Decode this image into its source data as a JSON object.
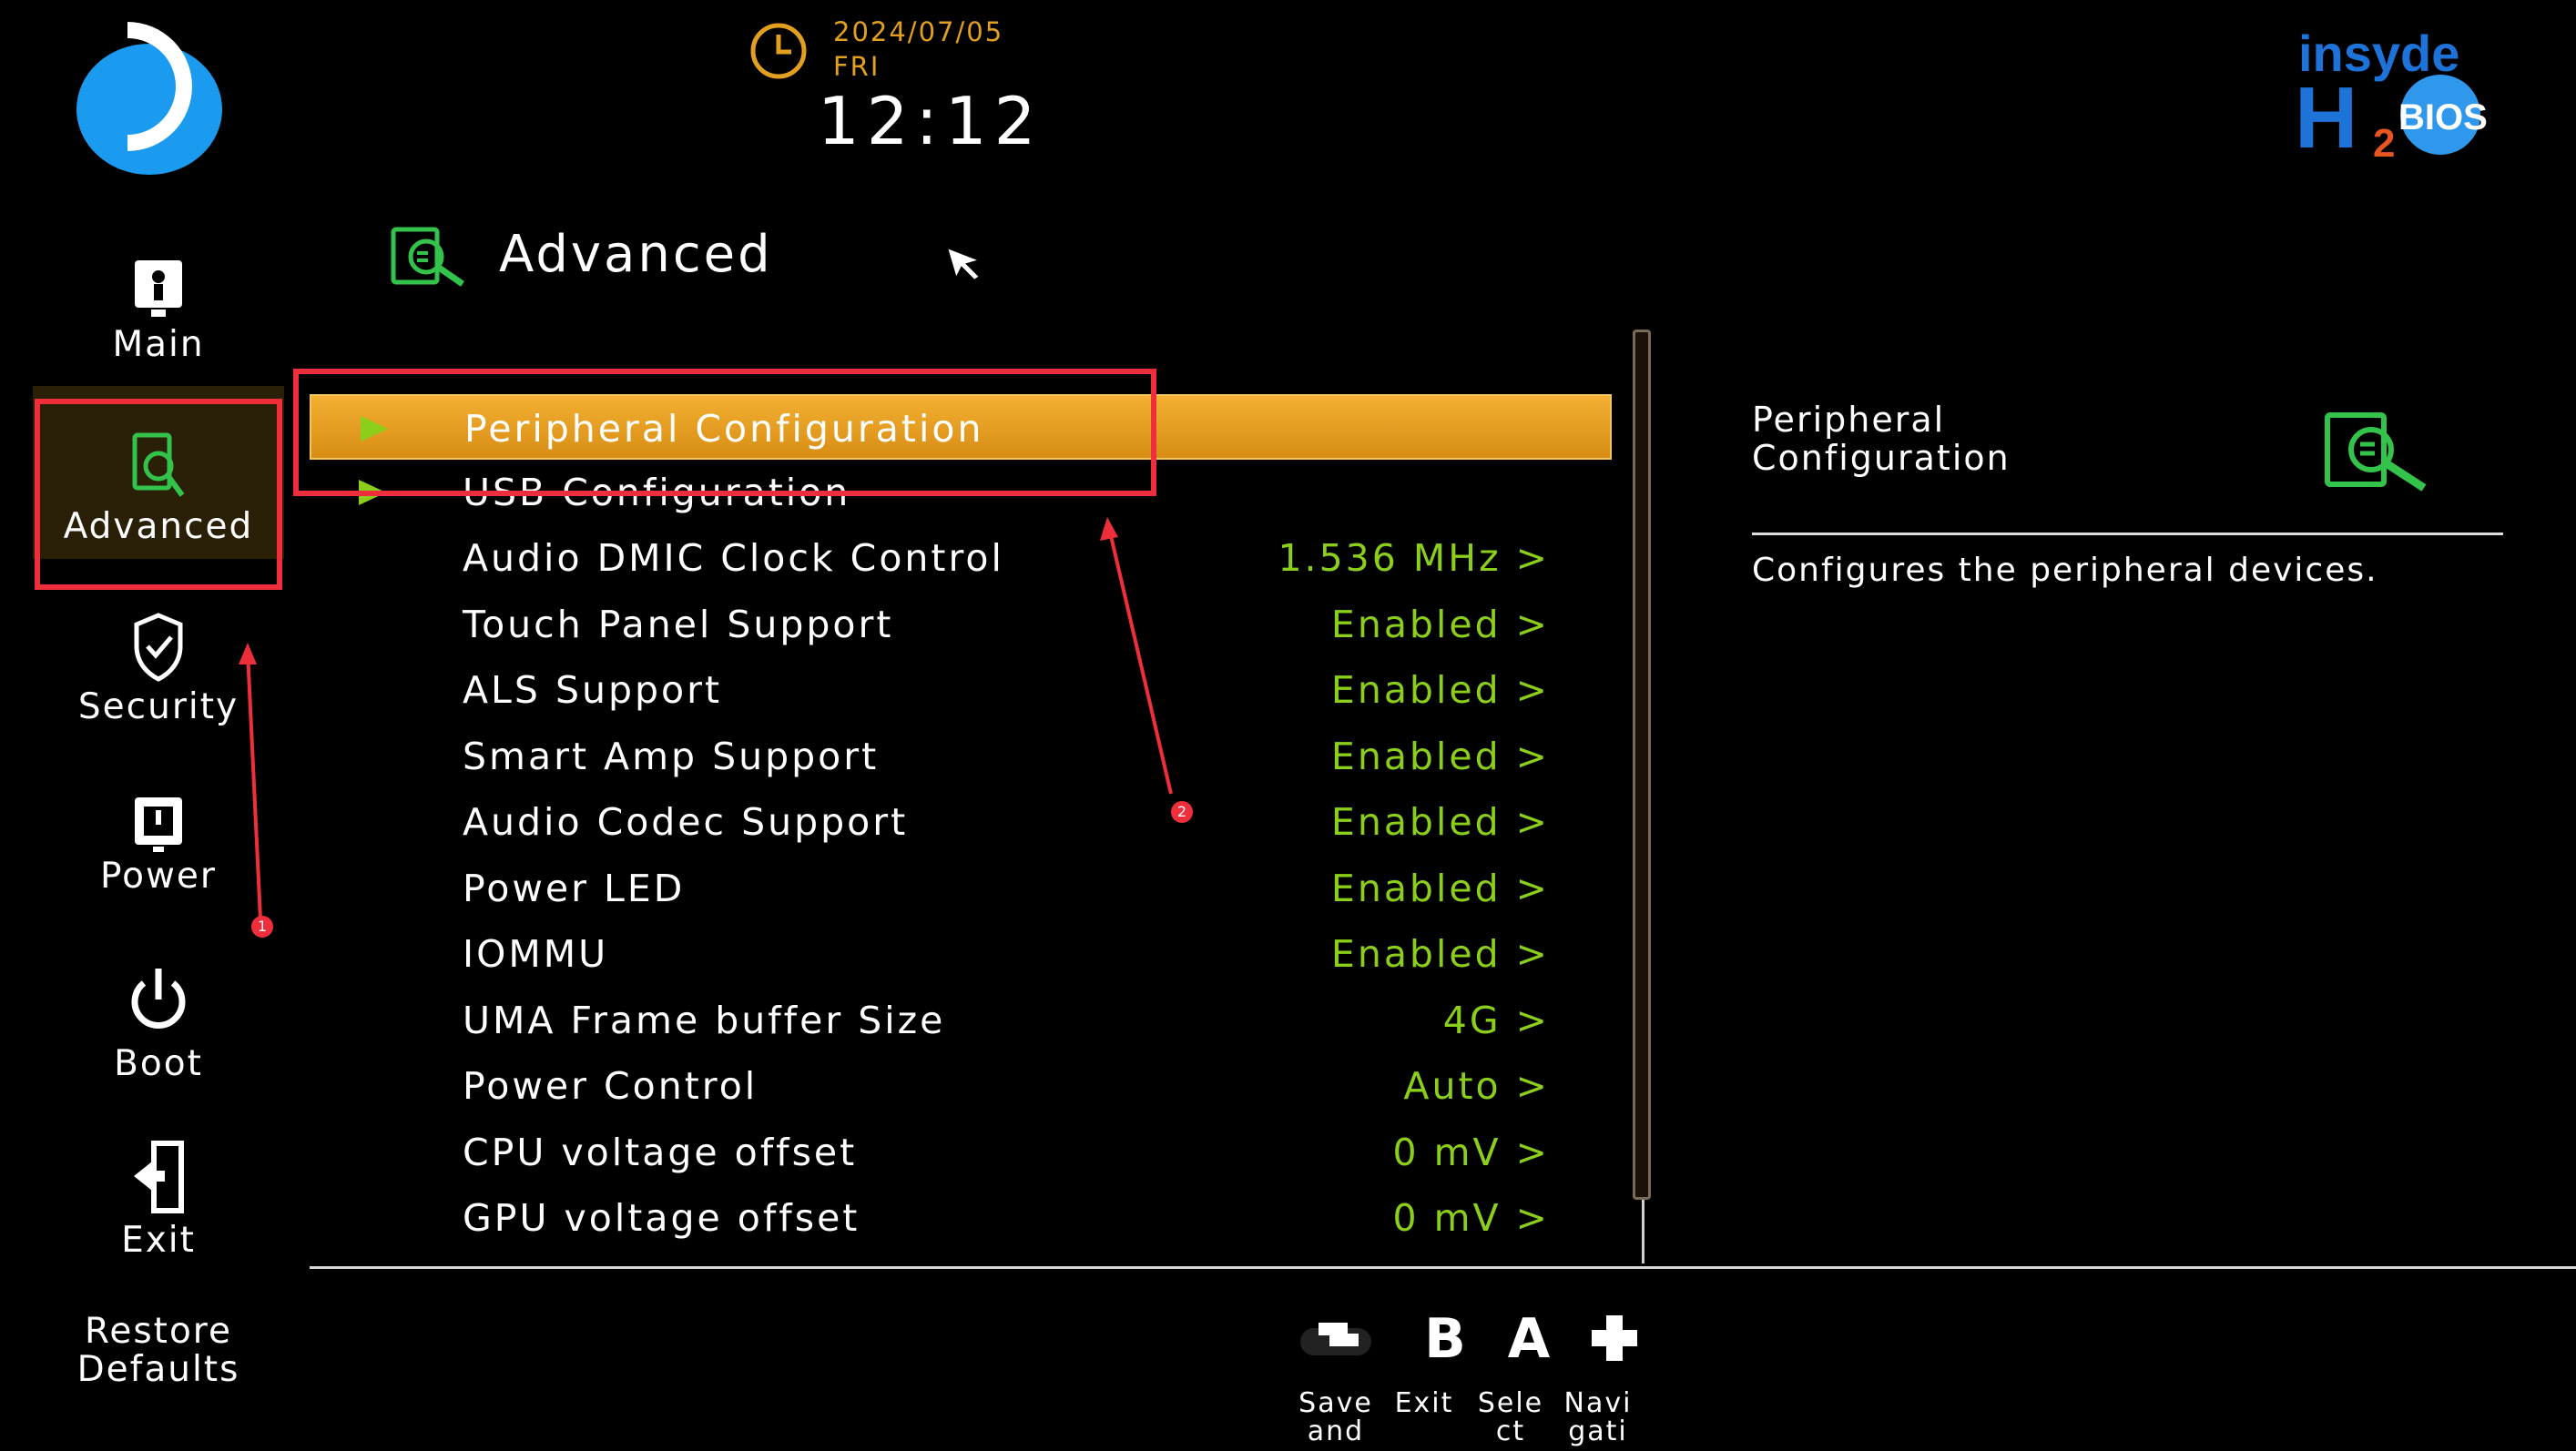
{
  "header": {
    "date": "2024/07/05",
    "weekday": "FRI",
    "time": "12:12",
    "brand_logo": "insyde H2 BIOS"
  },
  "sidebar": {
    "items": [
      {
        "label": "Main",
        "icon": "main-icon"
      },
      {
        "label": "Advanced",
        "icon": "advanced-icon",
        "active": true
      },
      {
        "label": "Security",
        "icon": "shield-icon"
      },
      {
        "label": "Power",
        "icon": "power-box-icon"
      },
      {
        "label": "Boot",
        "icon": "power-icon"
      },
      {
        "label": "Exit",
        "icon": "exit-door-icon"
      }
    ],
    "restore_line1": "Restore",
    "restore_line2": "Defaults"
  },
  "page": {
    "title": "Advanced"
  },
  "menu": {
    "items": [
      {
        "label": "Peripheral Configuration",
        "value": "",
        "submenu": true
      },
      {
        "label": "USB Configuration",
        "value": "",
        "submenu": true
      },
      {
        "label": "Audio DMIC Clock Control",
        "value": "1.536 MHz >"
      },
      {
        "label": "Touch Panel Support",
        "value": "Enabled >"
      },
      {
        "label": "ALS Support",
        "value": "Enabled >"
      },
      {
        "label": "Smart Amp Support",
        "value": "Enabled >"
      },
      {
        "label": "Audio Codec Support",
        "value": "Enabled >"
      },
      {
        "label": "Power LED",
        "value": "Enabled >"
      },
      {
        "label": "IOMMU",
        "value": "Enabled >"
      },
      {
        "label": "UMA Frame buffer Size",
        "value": "4G >"
      },
      {
        "label": "Power Control",
        "value": "Auto >"
      },
      {
        "label": "CPU voltage offset",
        "value": "0 mV >"
      },
      {
        "label": "GPU voltage offset",
        "value": "0 mV >"
      }
    ]
  },
  "help": {
    "title_line1": "Peripheral",
    "title_line2": "Configuration",
    "description": "Configures the peripheral devices."
  },
  "footer": {
    "buttons": [
      {
        "glyph": "",
        "label1": "Save",
        "label2": "and"
      },
      {
        "glyph": "B",
        "label1": "Exit",
        "label2": ""
      },
      {
        "glyph": "A",
        "label1": "Sele",
        "label2": "ct"
      },
      {
        "glyph": "",
        "label1": "Navi",
        "label2": "gati"
      }
    ]
  },
  "annotations": {
    "marker1": "1",
    "marker2": "2"
  },
  "colors": {
    "accent_orange": "#e8a020",
    "value_green": "#8ccf1a",
    "annotation_red": "#ee2f3b",
    "icon_green": "#33c24a"
  }
}
